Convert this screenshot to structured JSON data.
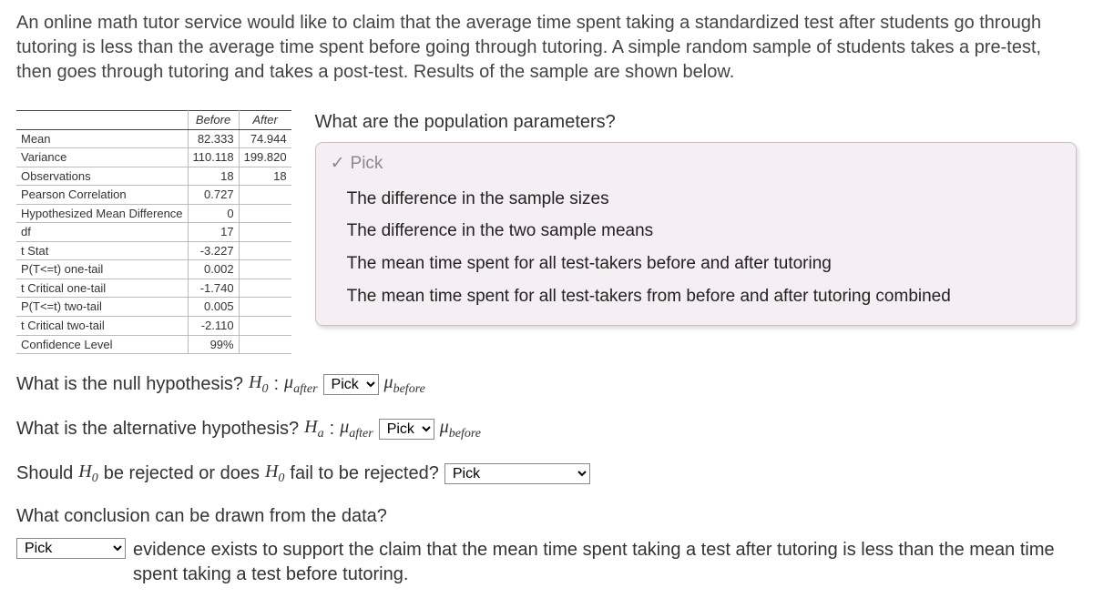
{
  "intro": "An online math tutor service would like to claim that the average time spent taking a standardized test after students go through tutoring is less than the average time spent before going through tutoring. A simple random sample of students takes a pre-test, then goes through tutoring and takes a post-test. Results of the sample are shown below.",
  "table": {
    "head_blank": "",
    "head_before": "Before",
    "head_after": "After",
    "rows": [
      {
        "label": "Mean",
        "before": "82.333",
        "after": "74.944"
      },
      {
        "label": "Variance",
        "before": "110.118",
        "after": "199.820"
      },
      {
        "label": "Observations",
        "before": "18",
        "after": "18"
      },
      {
        "label": "Pearson Correlation",
        "before": "0.727",
        "after": ""
      },
      {
        "label": "Hypothesized Mean Difference",
        "before": "0",
        "after": ""
      },
      {
        "label": "df",
        "before": "17",
        "after": ""
      },
      {
        "label": "t Stat",
        "before": "-3.227",
        "after": ""
      },
      {
        "label": "P(T<=t) one-tail",
        "before": "0.002",
        "after": ""
      },
      {
        "label": "t Critical one-tail",
        "before": "-1.740",
        "after": ""
      },
      {
        "label": "P(T<=t) two-tail",
        "before": "0.005",
        "after": ""
      },
      {
        "label": "t Critical two-tail",
        "before": "-2.110",
        "after": ""
      },
      {
        "label": "Confidence Level",
        "before": "99%",
        "after": ""
      }
    ]
  },
  "q_pop": {
    "title": "What are the population parameters?",
    "pick_label": "Pick",
    "options": [
      "The difference in the sample sizes",
      "The difference in the two sample means",
      "The mean time spent for all test-takers before and after tutoring",
      "The mean time spent for all test-takers from before and after tutoring combined"
    ]
  },
  "q_null": {
    "prefix": "What is the null hypothesis? ",
    "H": "H",
    "sub0": "0",
    "colon": " : ",
    "mu": "μ",
    "sub_after": "after",
    "pick": "Pick",
    "sub_before": "before"
  },
  "q_alt": {
    "prefix": "What is the alternative hypothesis? ",
    "H": "H",
    "suba": "a",
    "colon": " : ",
    "mu": "μ",
    "sub_after": "after",
    "pick": "Pick",
    "sub_before": "before"
  },
  "q_reject": {
    "prefix": "Should ",
    "H": "H",
    "sub0": "0",
    "mid": " be rejected or does ",
    "tail": " fail to be rejected? ",
    "pick": "Pick"
  },
  "q_concl": {
    "title": "What conclusion can be drawn from the data?",
    "pick": "Pick",
    "tail": "evidence exists to support the claim that the mean time spent taking a test after tutoring is less than the mean time spent taking a test before tutoring."
  }
}
